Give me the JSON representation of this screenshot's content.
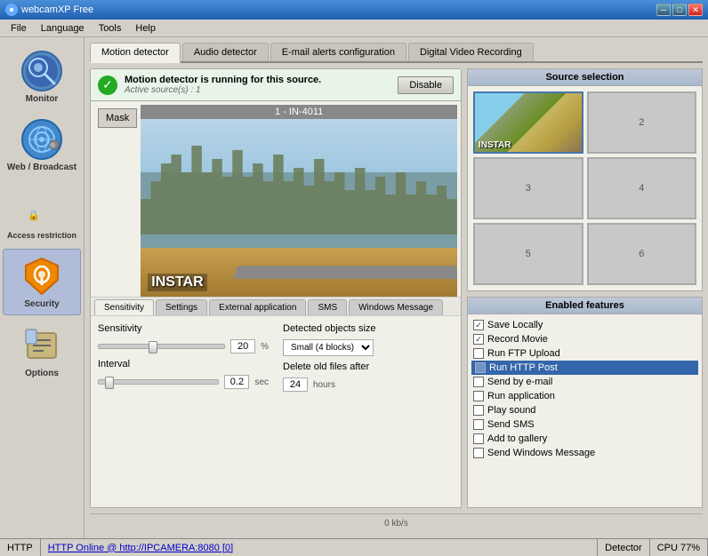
{
  "titlebar": {
    "title": "webcamXP Free",
    "icon": "🎥",
    "min_label": "─",
    "max_label": "□",
    "close_label": "✕"
  },
  "menubar": {
    "items": [
      "File",
      "Language",
      "Tools",
      "Help"
    ]
  },
  "sidebar": {
    "items": [
      {
        "id": "monitor",
        "label": "Monitor"
      },
      {
        "id": "broadcast",
        "label": "Web / Broadcast"
      },
      {
        "id": "access",
        "label": "Access restriction"
      },
      {
        "id": "security",
        "label": "Security"
      },
      {
        "id": "options",
        "label": "Options"
      }
    ]
  },
  "main_tabs": [
    {
      "id": "motion",
      "label": "Motion detector",
      "active": true
    },
    {
      "id": "audio",
      "label": "Audio detector"
    },
    {
      "id": "email",
      "label": "E-mail alerts configuration"
    },
    {
      "id": "dvr",
      "label": "Digital Video Recording"
    }
  ],
  "status": {
    "message": "Motion detector is running for this source.",
    "active_sources": "Active source(s) : 1",
    "disable_btn": "Disable"
  },
  "video": {
    "title": "1 - IN-4011",
    "mask_btn": "Mask"
  },
  "inner_tabs": [
    {
      "id": "sensitivity",
      "label": "Sensitivity",
      "active": true
    },
    {
      "id": "settings",
      "label": "Settings"
    },
    {
      "id": "external",
      "label": "External application"
    },
    {
      "id": "sms",
      "label": "SMS"
    },
    {
      "id": "winmsg",
      "label": "Windows Message"
    }
  ],
  "sensitivity": {
    "label": "Sensitivity",
    "value": "20",
    "unit": "%",
    "interval_label": "Interval",
    "interval_value": "0.2",
    "interval_unit": "sec",
    "detected_label": "Detected objects size",
    "detected_value": "Small (4 blocks)",
    "delete_label": "Delete old files after",
    "delete_value": "24",
    "delete_unit": "hours"
  },
  "source_selection": {
    "title": "Source selection",
    "cells": [
      {
        "id": 1,
        "label": "INSTAR",
        "has_image": true
      },
      {
        "id": 2,
        "label": "2",
        "has_image": false
      },
      {
        "id": 3,
        "label": "3",
        "has_image": false
      },
      {
        "id": 4,
        "label": "4",
        "has_image": false
      },
      {
        "id": 5,
        "label": "5",
        "has_image": false
      },
      {
        "id": 6,
        "label": "6",
        "has_image": false
      }
    ]
  },
  "features": {
    "title": "Enabled features",
    "items": [
      {
        "id": "save_locally",
        "label": "Save Locally",
        "checked": true,
        "highlighted": false
      },
      {
        "id": "record_movie",
        "label": "Record Movie",
        "checked": true,
        "highlighted": false
      },
      {
        "id": "ftp_upload",
        "label": "Run FTP Upload",
        "checked": false,
        "highlighted": false
      },
      {
        "id": "http_post",
        "label": "Run HTTP Post",
        "checked": false,
        "highlighted": true
      },
      {
        "id": "email",
        "label": "Send by e-mail",
        "checked": false,
        "highlighted": false
      },
      {
        "id": "run_app",
        "label": "Run application",
        "checked": false,
        "highlighted": false
      },
      {
        "id": "play_sound",
        "label": "Play sound",
        "checked": false,
        "highlighted": false
      },
      {
        "id": "send_sms",
        "label": "Send SMS",
        "checked": false,
        "highlighted": false
      },
      {
        "id": "add_gallery",
        "label": "Add to gallery",
        "checked": false,
        "highlighted": false
      },
      {
        "id": "win_message",
        "label": "Send Windows Message",
        "checked": false,
        "highlighted": false
      }
    ]
  },
  "bottom": {
    "speed": "0 kb/s",
    "detector_label": "Detector"
  },
  "statusbar": {
    "http_label": "HTTP",
    "link": "HTTP Online @ http://IPCAMERA:8080 [0]",
    "detector": "Detector",
    "cpu": "CPU 77%"
  }
}
